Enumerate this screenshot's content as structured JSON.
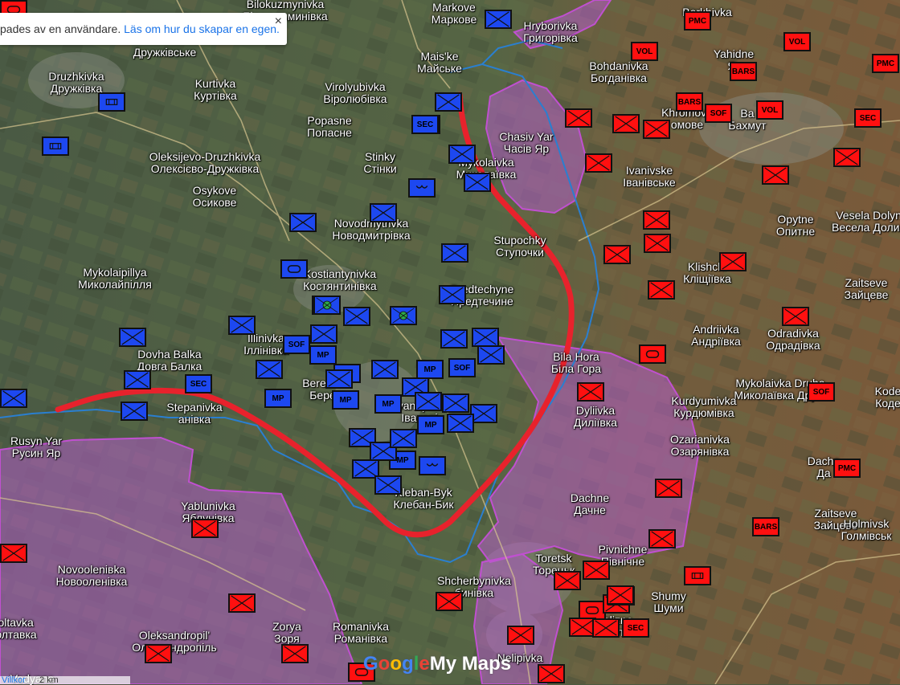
{
  "notice": {
    "text": "pades av en användare. ",
    "link": "Läs om hur du skapar en egen.",
    "close": "×"
  },
  "logo": {
    "google": [
      "G",
      "o",
      "o",
      "g",
      "l",
      "e"
    ],
    "product": "My Maps"
  },
  "scale": {
    "terms": "Villkor",
    "distance": "2 km"
  },
  "colors": {
    "ukraine_unit": "#1d48f0",
    "russia_unit": "#ff1010",
    "occupied_area": "#b45fc8",
    "front_line": "#e8222c",
    "contested_outline": "#2a7fd0"
  },
  "places": [
    {
      "latin": "Bilokuzmynivka",
      "cyr": "Білокузьминівка",
      "name": "bilokuzmynivka"
    },
    {
      "latin": "Markove",
      "cyr": "Маркове",
      "name": "markove"
    },
    {
      "latin": "Hryborivka",
      "cyr": "Григорівка",
      "name": "hryhorivka"
    },
    {
      "latin": "Berkhivka",
      "cyr": "",
      "name": "berkhivka"
    },
    {
      "latin": "Дружківське",
      "cyr": "",
      "name": "druzhkivske"
    },
    {
      "latin": "Druzhkivka",
      "cyr": "Дружківка",
      "name": "druzhkivka"
    },
    {
      "latin": "Mais'ke",
      "cyr": "Майське",
      "name": "maiske"
    },
    {
      "latin": "Yahidne",
      "cyr": "Яг",
      "name": "yahidne"
    },
    {
      "latin": "Bohdanivka",
      "cyr": "Богданівка",
      "name": "bohdanivka"
    },
    {
      "latin": "Kurtivka",
      "cyr": "Куртівка",
      "name": "kurtivka"
    },
    {
      "latin": "Virolyubivka",
      "cyr": "Віролюбівка",
      "name": "virolyubivka"
    },
    {
      "latin": "Popasne",
      "cyr": "Попасне",
      "name": "popasne"
    },
    {
      "latin": "Khromove",
      "cyr": "омове",
      "name": "khromove"
    },
    {
      "latin": "Ba",
      "cyr": "Бахмут",
      "name": "bakhmut"
    },
    {
      "latin": "Chasiv Yar",
      "cyr": "Часів Яр",
      "name": "chasiv-yar"
    },
    {
      "latin": "Oleksijevo-Druzhkivka",
      "cyr": "Олексієво-Дружківка",
      "name": "oleksiievo-druzhkivka"
    },
    {
      "latin": "Stinky",
      "cyr": "Стінки",
      "name": "stinky"
    },
    {
      "latin": "Mykolaivka",
      "cyr": "Миколаївка",
      "name": "mykolaivka"
    },
    {
      "latin": "Ivanivske",
      "cyr": "Іванівське",
      "name": "ivanivske"
    },
    {
      "latin": "Osykove",
      "cyr": "Осикове",
      "name": "osykove"
    },
    {
      "latin": "Opytne",
      "cyr": "Опитне",
      "name": "opytne"
    },
    {
      "latin": "Vesela Dolyna",
      "cyr": "Весела Долина",
      "name": "vesela-dolyna"
    },
    {
      "latin": "Novodmytrivka",
      "cyr": "Новодмитрівка",
      "name": "novodmytrivka"
    },
    {
      "latin": "Stupochky",
      "cyr": "Ступочки",
      "name": "stupochky"
    },
    {
      "latin": "Mykolaipillya",
      "cyr": "Миколайпілля",
      "name": "mykolaipillya"
    },
    {
      "latin": "Kostiantynivka",
      "cyr": "Костянтинівка",
      "name": "kostiantynivka"
    },
    {
      "latin": "Klishchi",
      "cyr": "Кліщіївка",
      "name": "klishchiivka"
    },
    {
      "latin": "Zaitseve",
      "cyr": "Зайцеве",
      "name": "zaitseve-n"
    },
    {
      "latin": "Predtechyne",
      "cyr": "Предтечине",
      "name": "predtechyne"
    },
    {
      "latin": "Andriivka",
      "cyr": "Андріївка",
      "name": "andriivka"
    },
    {
      "latin": "Odradivka",
      "cyr": "Одрадівка",
      "name": "odradivka"
    },
    {
      "latin": "Illinivka",
      "cyr": "Іллінівка",
      "name": "illinivka"
    },
    {
      "latin": "Dovha Balka",
      "cyr": "Довга Балка",
      "name": "dovha-balka"
    },
    {
      "latin": "Bila Hora",
      "cyr": "Біла Гора",
      "name": "bila-hora"
    },
    {
      "latin": "Mykolaivka Druha",
      "cyr": "Миколаївка Друга",
      "name": "mykolaivka-druha"
    },
    {
      "latin": "Kode",
      "cyr": "Коде",
      "name": "kodema"
    },
    {
      "latin": "Kurdyumivka",
      "cyr": "Курдюмівка",
      "name": "kurdyumivka"
    },
    {
      "latin": "Dyliivka",
      "cyr": "Диліївка",
      "name": "dyliivka"
    },
    {
      "latin": "Bereстоk",
      "cyr": "Берес",
      "name": "berestok"
    },
    {
      "latin": "Ivanopillia",
      "cyr": "Іванопі",
      "name": "ivanopillia"
    },
    {
      "latin": "Stepanivka",
      "cyr": "анівка",
      "name": "stepanivka"
    },
    {
      "latin": "Rusyn Yar",
      "cyr": "Русин Яр",
      "name": "rusyn-yar"
    },
    {
      "latin": "Ozarianivka",
      "cyr": "Озарянівка",
      "name": "ozarianivka"
    },
    {
      "latin": "Dacha",
      "cyr": "Да",
      "name": "dacha"
    },
    {
      "latin": "Kleban-Byk",
      "cyr": "Клебан-Бик",
      "name": "kleban-byk"
    },
    {
      "latin": "Yablunivka",
      "cyr": "Яблунівка",
      "name": "yablunivka"
    },
    {
      "latin": "Dachne",
      "cyr": "Дачне",
      "name": "dachne"
    },
    {
      "latin": "Zaitseve",
      "cyr": "Зайцеве",
      "name": "zaitseve-s"
    },
    {
      "latin": "Holmivsk",
      "cyr": "Голмівськ",
      "name": "holmivskyi"
    },
    {
      "latin": "Novooleniвka",
      "cyr": "Новоолeнівка",
      "name": "novoolenivka"
    },
    {
      "latin": "Toretsk",
      "cyr": "Торецьк",
      "name": "toretsk"
    },
    {
      "latin": "Pivnichne",
      "cyr": "Північне",
      "name": "pivnichne"
    },
    {
      "latin": "Shumy",
      "cyr": "Шуми",
      "name": "shumy"
    },
    {
      "latin": "Shcherbynivka",
      "cyr": "бинівка",
      "name": "shcherbynivka"
    },
    {
      "latin": "Zalizne",
      "cyr": "Залі",
      "name": "zalizne"
    },
    {
      "latin": "Poltavka",
      "cyr": "Полтавка",
      "name": "poltavka"
    },
    {
      "latin": "Oleksandropil'",
      "cyr": "Олександропіль",
      "name": "oleksandropil"
    },
    {
      "latin": "Zorya",
      "cyr": "Зоря",
      "name": "zorya"
    },
    {
      "latin": "Romanivka",
      "cyr": "Романівка",
      "name": "romanivka"
    },
    {
      "latin": "Nelipivka",
      "cyr": "",
      "name": "nelipivka"
    },
    {
      "latin": "Vodyane",
      "cyr": "",
      "name": "vodyane"
    }
  ],
  "unit_tags": {
    "mp": "MP",
    "sof": "SOF",
    "sec": "SEC",
    "pmc": "PMC",
    "vol": "VOL",
    "bars": "BARS"
  },
  "ukraine_units": [
    {
      "type": "infantry"
    },
    {
      "type": "recon"
    },
    {
      "type": "recon"
    },
    {
      "type": "infantry"
    },
    {
      "type": "recon"
    },
    {
      "type": "tag",
      "tag": "sec"
    },
    {
      "type": "tag",
      "tag": "sec"
    },
    {
      "type": "infantry"
    },
    {
      "type": "infantry"
    },
    {
      "type": "airborne"
    },
    {
      "type": "infantry"
    },
    {
      "type": "infantry"
    },
    {
      "type": "infantry"
    },
    {
      "type": "armor"
    },
    {
      "type": "infantry"
    },
    {
      "type": "infantry"
    },
    {
      "type": "infantry"
    },
    {
      "type": "airborne"
    },
    {
      "type": "infantry"
    },
    {
      "type": "infantry"
    },
    {
      "type": "infantry"
    },
    {
      "type": "tag",
      "tag": "sec"
    },
    {
      "type": "infantry"
    },
    {
      "type": "infantry"
    },
    {
      "type": "tag",
      "tag": "mp"
    },
    {
      "type": "tag",
      "tag": "mp"
    },
    {
      "type": "tag",
      "tag": "mp"
    },
    {
      "type": "tag",
      "tag": "mp"
    },
    {
      "type": "tag",
      "tag": "mp"
    },
    {
      "type": "tag",
      "tag": "mp"
    },
    {
      "type": "tag",
      "tag": "mp"
    },
    {
      "type": "tag",
      "tag": "mp"
    },
    {
      "type": "tag",
      "tag": "sof"
    },
    {
      "type": "tag",
      "tag": "sof"
    },
    {
      "type": "infantry"
    },
    {
      "type": "infantry"
    },
    {
      "type": "infantry"
    },
    {
      "type": "infantry"
    },
    {
      "type": "infantry"
    },
    {
      "type": "infantry"
    },
    {
      "type": "infantry"
    },
    {
      "type": "infantry"
    },
    {
      "type": "infantry"
    },
    {
      "type": "airborne"
    },
    {
      "type": "infantry"
    },
    {
      "type": "infantry"
    },
    {
      "type": "infantry"
    },
    {
      "type": "infantry"
    },
    {
      "type": "infantry"
    },
    {
      "type": "infantry"
    },
    {
      "type": "infantry"
    },
    {
      "type": "artillery"
    },
    {
      "type": "artillery"
    },
    {
      "type": "infantry"
    }
  ],
  "russia_units": [
    {
      "type": "tag",
      "tag": "pmc"
    },
    {
      "type": "tag",
      "tag": "vol"
    },
    {
      "type": "tag",
      "tag": "vol"
    },
    {
      "type": "tag",
      "tag": "pmc"
    },
    {
      "type": "tag",
      "tag": "bars"
    },
    {
      "type": "tag",
      "tag": "bars"
    },
    {
      "type": "tag",
      "tag": "sof"
    },
    {
      "type": "tag",
      "tag": "vol"
    },
    {
      "type": "tag",
      "tag": "sec"
    },
    {
      "type": "infantry"
    },
    {
      "type": "infantry"
    },
    {
      "type": "infantry"
    },
    {
      "type": "infantry"
    },
    {
      "type": "infantry"
    },
    {
      "type": "infantry"
    },
    {
      "type": "infantry"
    },
    {
      "type": "infantry"
    },
    {
      "type": "infantry"
    },
    {
      "type": "infantry"
    },
    {
      "type": "infantry"
    },
    {
      "type": "infantry"
    },
    {
      "type": "infantry"
    },
    {
      "type": "armor"
    },
    {
      "type": "infantry"
    },
    {
      "type": "infantry"
    },
    {
      "type": "tag",
      "tag": "sof"
    },
    {
      "type": "tag",
      "tag": "pmc"
    },
    {
      "type": "infantry"
    },
    {
      "type": "infantry"
    },
    {
      "type": "tag",
      "tag": "bars"
    },
    {
      "type": "infantry"
    },
    {
      "type": "recon"
    },
    {
      "type": "infantry"
    },
    {
      "type": "infantry"
    },
    {
      "type": "infantry"
    },
    {
      "type": "infantry"
    },
    {
      "type": "armor"
    },
    {
      "type": "infantry"
    },
    {
      "type": "infantry"
    },
    {
      "type": "tag",
      "tag": "sec"
    },
    {
      "type": "infantry"
    },
    {
      "type": "armor"
    },
    {
      "type": "infantry"
    },
    {
      "type": "infantry"
    },
    {
      "type": "tag",
      "tag": "sof"
    },
    {
      "type": "infantry"
    },
    {
      "type": "infantry"
    },
    {
      "type": "armor"
    }
  ]
}
